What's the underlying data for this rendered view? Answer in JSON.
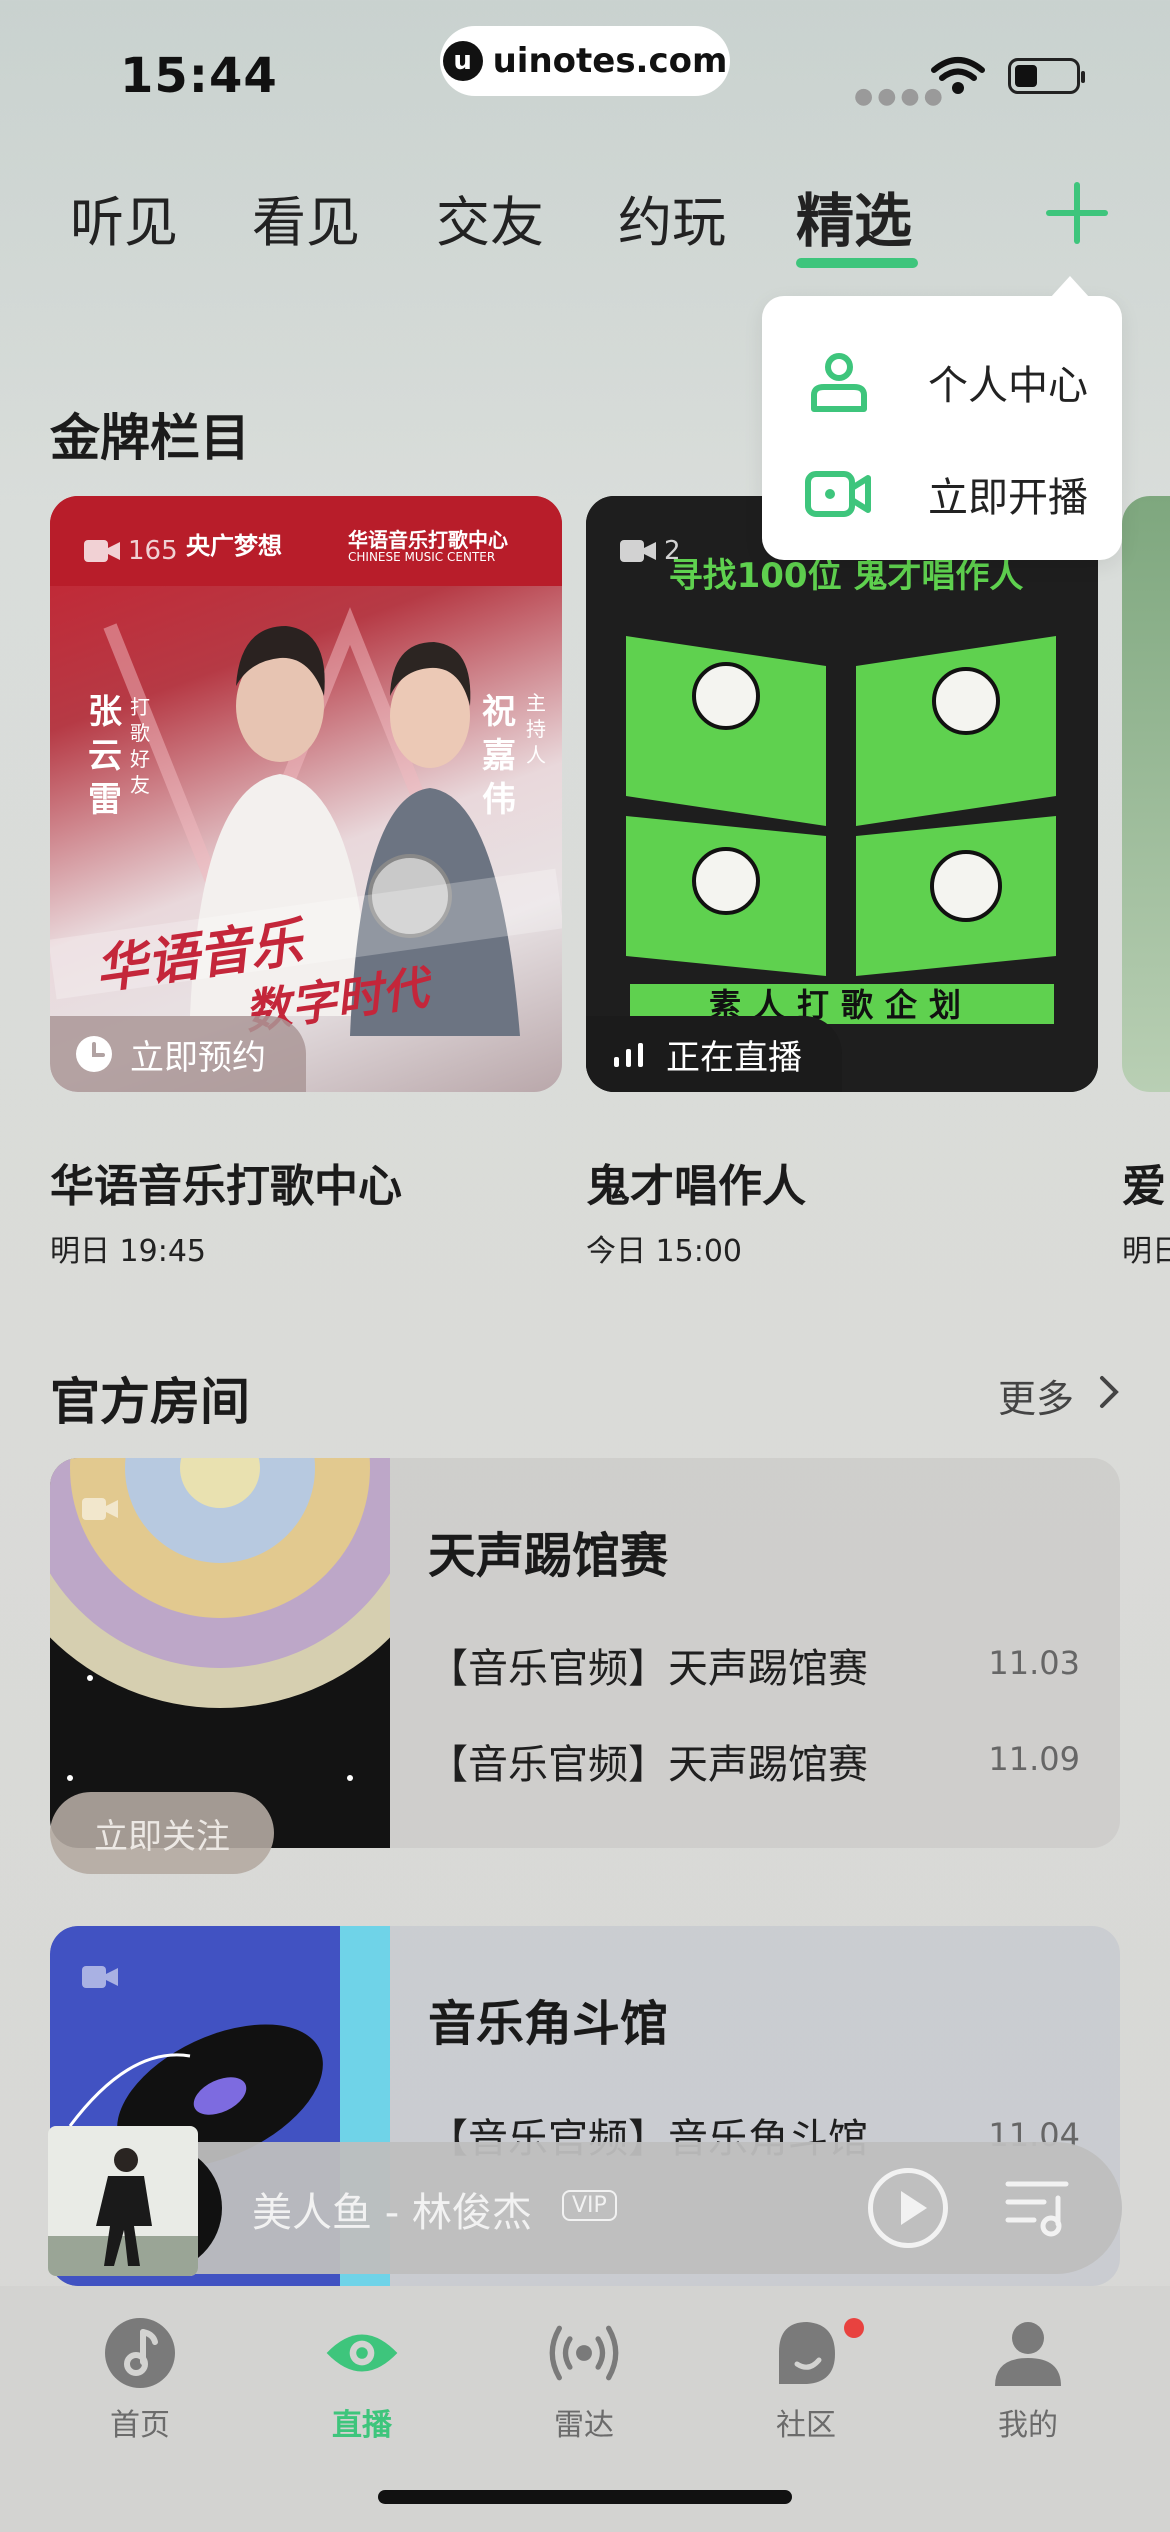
{
  "status_bar": {
    "time": "15:44",
    "url": "uinotes.com"
  },
  "top_tabs": [
    {
      "label": "听见"
    },
    {
      "label": "看见"
    },
    {
      "label": "交友"
    },
    {
      "label": "约玩"
    },
    {
      "label": "精选",
      "active": true
    }
  ],
  "popover": {
    "items": [
      {
        "label": "个人中心",
        "icon": "person-icon"
      },
      {
        "label": "立即开播",
        "icon": "video-camera-icon"
      }
    ]
  },
  "gold": {
    "title": "金牌栏目",
    "cards": [
      {
        "name": "华语音乐打歌中心",
        "time": "明日 19:45",
        "tag": "立即预约",
        "count": "165",
        "poster": {
          "brand1": "央广梦想",
          "brand2": "华语音乐打歌中心",
          "brand2_en": "CHINESE MUSIC CENTER",
          "host1": "张云雷",
          "host1_role": "打歌好友",
          "host2": "祝嘉伟",
          "host2_role": "主持人",
          "slogan1": "华语音乐",
          "slogan2": "数字时代"
        }
      },
      {
        "name": "鬼才唱作人",
        "time": "今日 15:00",
        "tag": "正在直播",
        "count": "2",
        "poster": {
          "headline": "寻找100位 鬼才唱作人",
          "banner": "素人打歌企划"
        }
      },
      {
        "name": "爱",
        "time": "明日"
      }
    ]
  },
  "official": {
    "title": "官方房间",
    "more": "更多",
    "rooms": [
      {
        "title": "天声踢馆赛",
        "follow": "立即关注",
        "lines": [
          {
            "text": "【音乐官频】天声踢馆赛",
            "date": "11.03"
          },
          {
            "text": "【音乐官频】天声踢馆赛",
            "date": "11.09"
          }
        ]
      },
      {
        "title": "音乐角斗馆",
        "lines": [
          {
            "text": "【音乐官频】音乐角斗馆",
            "date": "11.04"
          }
        ]
      }
    ]
  },
  "player": {
    "song": "美人鱼 - 林俊杰",
    "vip": "VIP"
  },
  "bottom_tabs": [
    {
      "label": "首页"
    },
    {
      "label": "直播",
      "active": true
    },
    {
      "label": "雷达"
    },
    {
      "label": "社区"
    },
    {
      "label": "我的"
    }
  ],
  "colors": {
    "accent": "#3ec57c",
    "badge": "#e8423f"
  }
}
